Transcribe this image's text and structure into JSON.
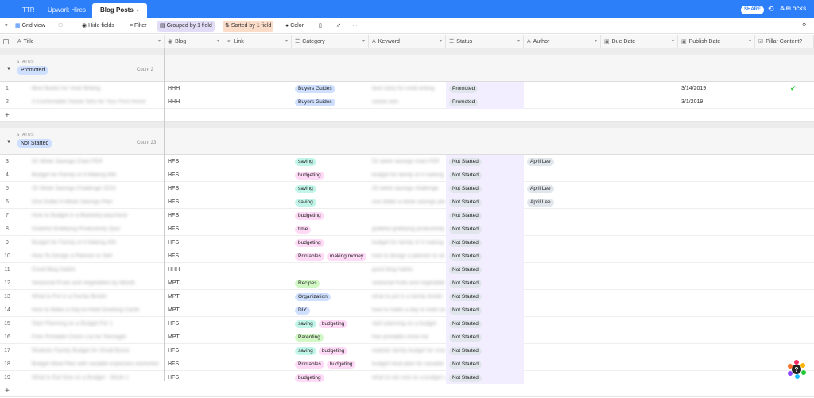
{
  "tabs": [
    "TTR",
    "Upwork Hires",
    "Blog Posts"
  ],
  "topbar": {
    "share": "SHARE",
    "blocks": "BLOCKS"
  },
  "toolbar": {
    "view": "Grid view",
    "hide_fields": "Hide fields",
    "filter": "Filter",
    "grouped": "Grouped by 1 field",
    "sorted": "Sorted by 1 field",
    "color": "Color"
  },
  "columns": [
    "Title",
    "Blog",
    "Link",
    "Category",
    "Keyword",
    "Status",
    "Author",
    "Due Date",
    "Publish Date",
    "Pillar Content?"
  ],
  "groups": [
    {
      "label": "STATUS",
      "name": "Promoted",
      "count": "Count 2",
      "rows": [
        {
          "n": "1",
          "title": "Best Books for Vivid Writing",
          "blog": "HHH",
          "cats": [
            [
              "Buyers Guides",
              "p-blue"
            ]
          ],
          "keyword": "best story for vivid writing",
          "status": "Promoted",
          "author": "",
          "publish": "3/14/2019",
          "pillar": true
        },
        {
          "n": "2",
          "title": "3 Comfortable Sweat Sets for Your First Home",
          "blog": "HHH",
          "cats": [
            [
              "Buyers Guides",
              "p-blue"
            ]
          ],
          "keyword": "sweat sets",
          "status": "Promoted",
          "author": "",
          "publish": "3/1/2019",
          "pillar": false
        }
      ]
    },
    {
      "label": "STATUS",
      "name": "Not Started",
      "count": "Count 23",
      "rows": [
        {
          "n": "3",
          "title": "52 Week Savings Chart PDF",
          "blog": "HFS",
          "cats": [
            [
              "saving",
              "p-teal"
            ]
          ],
          "keyword": "52 week savings chart PDF",
          "status": "Not Started",
          "author": "April Lee"
        },
        {
          "n": "4",
          "title": "Budget for Family of 4 Making 60k",
          "blog": "HFS",
          "cats": [
            [
              "budgeting",
              "p-pink"
            ]
          ],
          "keyword": "budget for family of 4 making",
          "status": "Not Started",
          "author": ""
        },
        {
          "n": "5",
          "title": "20 Week Savings Challenge 2019",
          "blog": "HFS",
          "cats": [
            [
              "saving",
              "p-teal"
            ]
          ],
          "keyword": "20 week savings challenge",
          "status": "Not Started",
          "author": "April Lee"
        },
        {
          "n": "6",
          "title": "One Dollar A Week Savings Plan",
          "blog": "HFS",
          "cats": [
            [
              "saving",
              "p-teal"
            ]
          ],
          "keyword": "one dollar a week savings plan",
          "status": "Not Started",
          "author": "April Lee"
        },
        {
          "n": "7",
          "title": "How to Budget in a Biweekly paycheck",
          "blog": "HFS",
          "cats": [
            [
              "budgeting",
              "p-pink"
            ]
          ],
          "keyword": "",
          "status": "Not Started",
          "author": ""
        },
        {
          "n": "8",
          "title": "Grateful Gratifying Productivity Quiz",
          "blog": "HFS",
          "cats": [
            [
              "time",
              "p-pink"
            ]
          ],
          "keyword": "grateful gratifying productivity",
          "status": "Not Started",
          "author": ""
        },
        {
          "n": "9",
          "title": "Budget for Family of 4 Making 40k",
          "blog": "HFS",
          "cats": [
            [
              "budgeting",
              "p-pink"
            ]
          ],
          "keyword": "budget for family of 4 making",
          "status": "Not Started",
          "author": ""
        },
        {
          "n": "10",
          "title": "How To Design a Planner or Self",
          "blog": "HFS",
          "cats": [
            [
              "Printables",
              "p-pink"
            ],
            [
              "making money",
              "p-pink"
            ]
          ],
          "keyword": "how to design a planner to sell",
          "status": "Not Started",
          "author": ""
        },
        {
          "n": "11",
          "title": "Good Blog Habits",
          "blog": "HHH",
          "cats": [],
          "keyword": "good blog habits",
          "status": "Not Started",
          "author": ""
        },
        {
          "n": "12",
          "title": "Seasonal Fruits and Vegetables by Month",
          "blog": "MPT",
          "cats": [
            [
              "Recipes",
              "p-green"
            ]
          ],
          "keyword": "seasonal fruits and vegetables",
          "status": "Not Started",
          "author": ""
        },
        {
          "n": "13",
          "title": "What to Put in a Family Binder",
          "blog": "MPT",
          "cats": [
            [
              "Organization",
              "p-blue"
            ]
          ],
          "keyword": "what to put in a family binder",
          "status": "Not Started",
          "author": ""
        },
        {
          "n": "14",
          "title": "How to Make a Day-to-Hold Greeting Cards",
          "blog": "MPT",
          "cats": [
            [
              "DIY",
              "p-blue"
            ]
          ],
          "keyword": "how to make a day to hold cards",
          "status": "Not Started",
          "author": ""
        },
        {
          "n": "15",
          "title": "Start Planning on a Budget For 1",
          "blog": "HFS",
          "cats": [
            [
              "saving",
              "p-teal"
            ],
            [
              "budgeting",
              "p-pink"
            ]
          ],
          "keyword": "start planning on a budget",
          "status": "Not Started",
          "author": ""
        },
        {
          "n": "16",
          "title": "Free Printable Chore List for Teenager",
          "blog": "MPT",
          "cats": [
            [
              "Parenting",
              "p-green"
            ]
          ],
          "keyword": "free printable chore list",
          "status": "Not Started",
          "author": ""
        },
        {
          "n": "17",
          "title": "Realistic Family Budget for Small Boost",
          "blog": "HFS",
          "cats": [
            [
              "saving",
              "p-teal"
            ],
            [
              "budgeting",
              "p-pink"
            ]
          ],
          "keyword": "realistic family budget for small",
          "status": "Not Started",
          "author": ""
        },
        {
          "n": "18",
          "title": "Budget Meal Plan with variable expenses worksheet",
          "blog": "HFS",
          "cats": [
            [
              "Printables",
              "p-pink"
            ],
            [
              "budgeting",
              "p-pink"
            ]
          ],
          "keyword": "budget meal plan for variable",
          "status": "Not Started",
          "author": ""
        },
        {
          "n": "19",
          "title": "What to Eat Now on a Budget - Week 1",
          "blog": "HFS",
          "cats": [
            [
              "budgeting",
              "p-pink"
            ]
          ],
          "keyword": "what to eat now on a budget week",
          "status": "Not Started",
          "author": ""
        }
      ]
    }
  ]
}
